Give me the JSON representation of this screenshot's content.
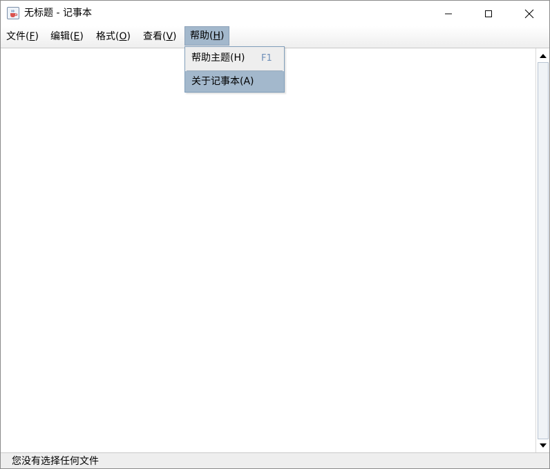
{
  "window": {
    "title": "无标题 - 记事本",
    "app_icon": "java-cup-icon",
    "controls": [
      "minimize-icon",
      "maximize-icon",
      "close-icon"
    ]
  },
  "menubar": {
    "items": [
      {
        "label": "文件(",
        "mnemonic": "F",
        "suffix": ")"
      },
      {
        "label": "编辑(",
        "mnemonic": "E",
        "suffix": ")"
      },
      {
        "label": "格式(",
        "mnemonic": "O",
        "suffix": ")"
      },
      {
        "label": "查看(",
        "mnemonic": "V",
        "suffix": ")"
      },
      {
        "label": "帮助(",
        "mnemonic": "H",
        "suffix": ")"
      }
    ],
    "active_index": 4
  },
  "help_menu": {
    "items": [
      {
        "label": "帮助主题(H)",
        "accelerator": "F1"
      },
      {
        "label": "关于记事本(A)"
      }
    ]
  },
  "editor": {
    "content": ""
  },
  "statusbar": {
    "text": "您没有选择任何文件"
  },
  "colors": {
    "menu_highlight": "#a3b8cc",
    "menu_border": "#7f9db9",
    "accelerator": "#6f8fb8"
  }
}
